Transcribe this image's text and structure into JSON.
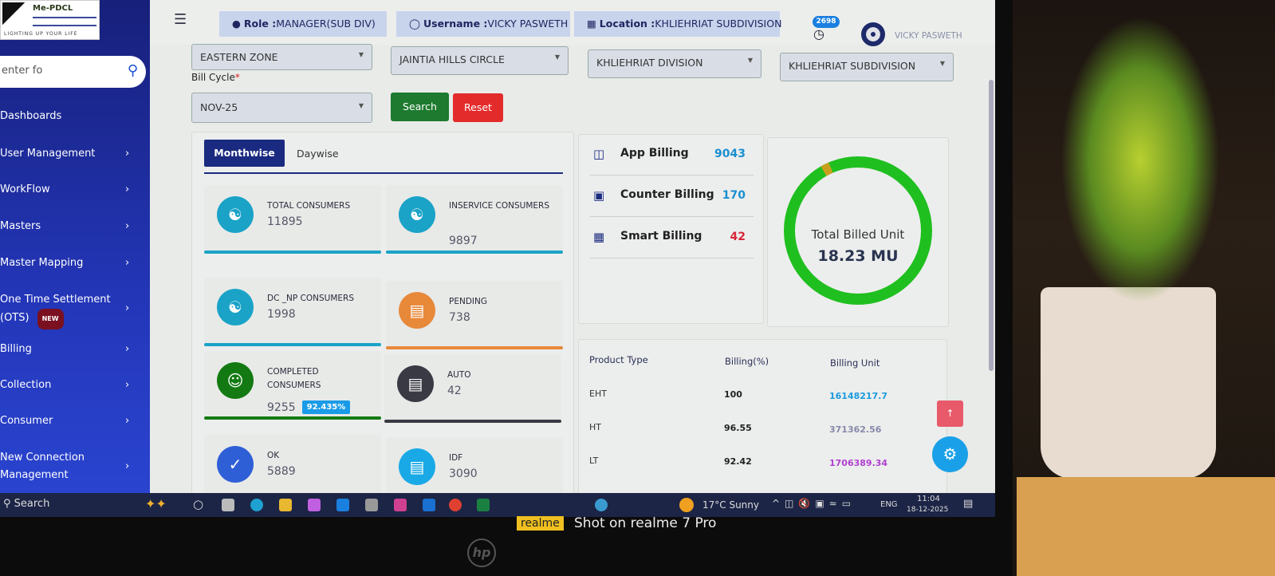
{
  "logo": {
    "name": "Me-PDCL",
    "tagline": "LIGHTING UP YOUR LIFE"
  },
  "sidebar": {
    "search_placeholder": "enter fo",
    "items": [
      {
        "label": "Dashboards"
      },
      {
        "label": "User Management"
      },
      {
        "label": "WorkFlow"
      },
      {
        "label": "Masters"
      },
      {
        "label": "Master Mapping"
      },
      {
        "label": "One Time Settlement",
        "label2": "(OTS)",
        "badge": "NEW"
      },
      {
        "label": "Billing"
      },
      {
        "label": "Collection"
      },
      {
        "label": "Consumer"
      },
      {
        "label": "New Connection",
        "label2": "Management"
      }
    ]
  },
  "header": {
    "role_label": "Role :",
    "role": "MANAGER(SUB DIV)",
    "username_label": "Username :",
    "username": "VICKY PASWETH",
    "location_label": "Location :",
    "location": "KHLIEHRIAT SUBDIVISION",
    "notification_count": "2698",
    "user_name": "VICKY PASWETH"
  },
  "filters": {
    "zone": "EASTERN ZONE",
    "circle": "JAINTIA HILLS CIRCLE",
    "division": "KHLIEHRIAT DIVISION",
    "subdivision": "KHLIEHRIAT SUBDIVISION",
    "bill_cycle_label": "Bill Cycle",
    "required_mark": "*",
    "bill_cycle": "NOV-25",
    "search": "Search",
    "reset": "Reset"
  },
  "tabs": {
    "monthwise": "Monthwise",
    "daywise": "Daywise"
  },
  "stats": [
    {
      "label": "TOTAL CONSUMERS",
      "value": "11895",
      "color": "#1aa3c7"
    },
    {
      "label": "INSERVICE CONSUMERS",
      "value": "9897",
      "color": "#1aa3c7"
    },
    {
      "label": "DC _NP CONSUMERS",
      "value": "1998",
      "color": "#1aa3c7"
    },
    {
      "label": "PENDING",
      "value": "738",
      "color": "#e8893a"
    },
    {
      "label": "COMPLETED CONSUMERS",
      "value": "9255",
      "badge": "92.435%",
      "color": "#137a13"
    },
    {
      "label": "AUTO",
      "value": "42",
      "color": "#3a3a44"
    },
    {
      "label": "OK",
      "value": "5889",
      "color": "#2f5fd6"
    },
    {
      "label": "IDF",
      "value": "3090",
      "color": "#19a9e6"
    }
  ],
  "billing": [
    {
      "label": "App Billing",
      "value": "9043",
      "color": "#1a8fd0"
    },
    {
      "label": "Counter Billing",
      "value": "170",
      "color": "#1a8fd0"
    },
    {
      "label": "Smart Billing",
      "value": "42",
      "color": "#d8263a"
    }
  ],
  "donut": {
    "label": "Total Billed Unit",
    "value": "18.23 MU"
  },
  "table": {
    "headers": [
      "Product Type",
      "Billing(%)",
      "Billing Unit"
    ],
    "rows": [
      {
        "type": "EHT",
        "pct": "100",
        "unit": "16148217.7",
        "color": "#1a9be0"
      },
      {
        "type": "HT",
        "pct": "96.55",
        "unit": "371362.56",
        "color": "#8888aa"
      },
      {
        "type": "LT",
        "pct": "92.42",
        "unit": "1706389.34",
        "color": "#b040d0"
      }
    ]
  },
  "taskbar": {
    "search": "Search",
    "weather": "17°C  Sunny",
    "lang": "ENG",
    "time": "11:04",
    "date": "18-12-2025"
  },
  "watermark": {
    "brand": "realme",
    "text": "Shot on realme 7 Pro"
  },
  "monitor_brand": "hp"
}
